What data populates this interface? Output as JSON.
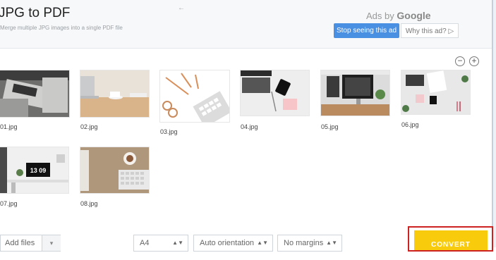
{
  "header": {
    "title": "JPG to PDF",
    "subtitle": "Merge multiple JPG images into a single PDF file",
    "back_glyph": "←"
  },
  "ads": {
    "ads_by": "Ads by",
    "google": "Google",
    "stop_label": "Stop seeing this ad",
    "why_label": "Why this ad? ▷"
  },
  "zoom": {
    "out_glyph": "−",
    "in_glyph": "+"
  },
  "images": [
    {
      "file": "01.jpg"
    },
    {
      "file": "02.jpg"
    },
    {
      "file": "03.jpg"
    },
    {
      "file": "04.jpg"
    },
    {
      "file": "05.jpg"
    },
    {
      "file": "06.jpg"
    },
    {
      "file": "07.jpg"
    },
    {
      "file": "08.jpg"
    }
  ],
  "photo_text": {
    "clock_time": "13 09"
  },
  "footer": {
    "add_files": "Add files",
    "add_files_arrow": "▾",
    "page_size": "A4",
    "orientation": "Auto orientation",
    "margins": "No margins",
    "select_arrows": "▲▼",
    "convert": "CONVERT"
  },
  "colors": {
    "convert_bg": "#f9cb0d",
    "convert_outline": "#cc2222",
    "ad_button": "#4a90e2"
  }
}
